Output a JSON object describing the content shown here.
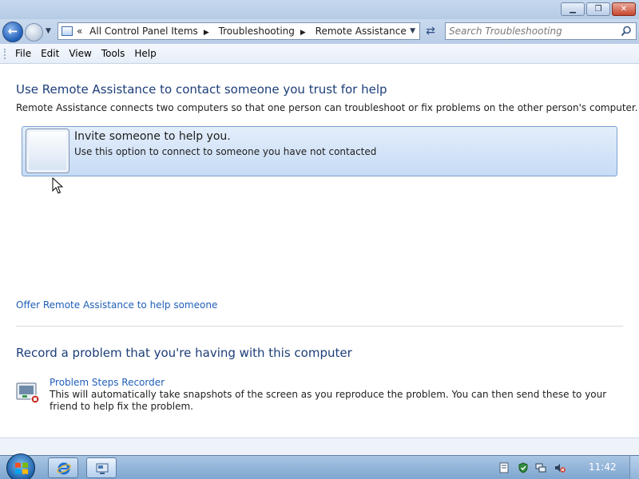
{
  "window": {
    "controls": [
      {
        "name": "minimize",
        "glyph": "▁"
      },
      {
        "name": "maximize",
        "glyph": "❐"
      },
      {
        "name": "close",
        "glyph": "✕"
      }
    ]
  },
  "navbar": {
    "breadcrumbs": [
      "All Control Panel Items",
      "Troubleshooting",
      "Remote Assistance"
    ],
    "overflow": "«",
    "search": {
      "placeholder": "Search Troubleshooting",
      "value": ""
    }
  },
  "menu": {
    "items": [
      "File",
      "Edit",
      "View",
      "Tools",
      "Help"
    ]
  },
  "main": {
    "heading": "Use Remote Assistance to contact someone you trust for help",
    "description": "Remote Assistance connects two computers so that one person can troubleshoot or fix problems on the other person's computer.",
    "invite": {
      "title": "Invite someone to help you.",
      "subtitle": "Use this option to connect to someone you have not contacted"
    },
    "offer_link": "Offer Remote Assistance to help someone",
    "record_heading": "Record a problem that you're having with this computer",
    "psr": {
      "link": "Problem Steps Recorder",
      "description": "This will automatically take snapshots of the screen as you reproduce the problem. You can then send these to your friend to help fix the problem."
    }
  },
  "taskbar": {
    "pinned": [
      "internet-explorer-icon",
      "remote-assistance-icon"
    ],
    "tray_icons": [
      "document-icon",
      "shield-check-icon",
      "network-icon",
      "volume-muted-icon"
    ],
    "clock": "11:42"
  },
  "colors": {
    "heading": "#1c3e78",
    "link": "#1f5fb8",
    "invite_bg": "#c6dbf5",
    "taskbar": "#7fa6cf"
  }
}
